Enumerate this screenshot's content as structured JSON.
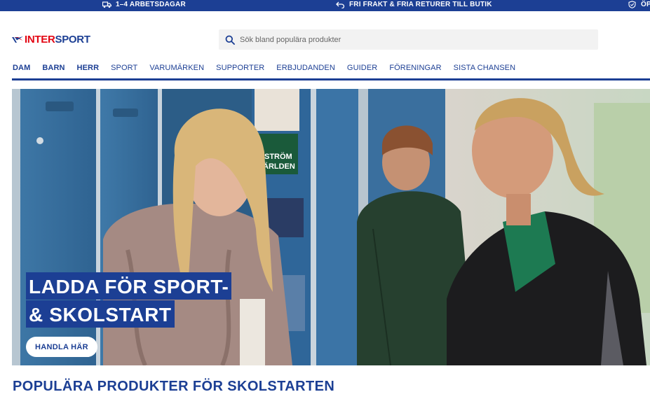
{
  "topbar": {
    "delivery": {
      "icon": "truck-icon",
      "text": "1–4 ARBETSDAGAR"
    },
    "returns": {
      "icon": "return-arrow-icon",
      "text": "FRI FRAKT & FRIA RETURER TILL BUTIK"
    },
    "extra": {
      "icon": "shield-check-icon",
      "text": "ÖP"
    }
  },
  "header": {
    "logo": {
      "part1": "INTER",
      "part2": "SPORT"
    },
    "search": {
      "placeholder": "Sök bland populära produkter",
      "icon": "search-icon"
    }
  },
  "nav": {
    "items": [
      {
        "label": "DAM",
        "bold": true
      },
      {
        "label": "BARN",
        "bold": true
      },
      {
        "label": "HERR",
        "bold": true
      },
      {
        "label": "SPORT",
        "bold": false
      },
      {
        "label": "VARUMÄRKEN",
        "bold": false
      },
      {
        "label": "SUPPORTER",
        "bold": false
      },
      {
        "label": "ERBJUDANDEN",
        "bold": false
      },
      {
        "label": "GUIDER",
        "bold": false
      },
      {
        "label": "FÖRENINGAR",
        "bold": false
      },
      {
        "label": "SISTA CHANSEN",
        "bold": false
      }
    ]
  },
  "hero": {
    "headline_line1": "LADDA FÖR SPORT-",
    "headline_line2": "& SKOLSTART",
    "cta": "HANDLA HÄR",
    "locker_sticker": "STRÖM\nÄRLDEN"
  },
  "section": {
    "title": "POPULÄRA PRODUKTER FÖR SKOLSTARTEN"
  },
  "colors": {
    "brand_blue": "#1c3f94",
    "brand_red": "#e30613"
  }
}
